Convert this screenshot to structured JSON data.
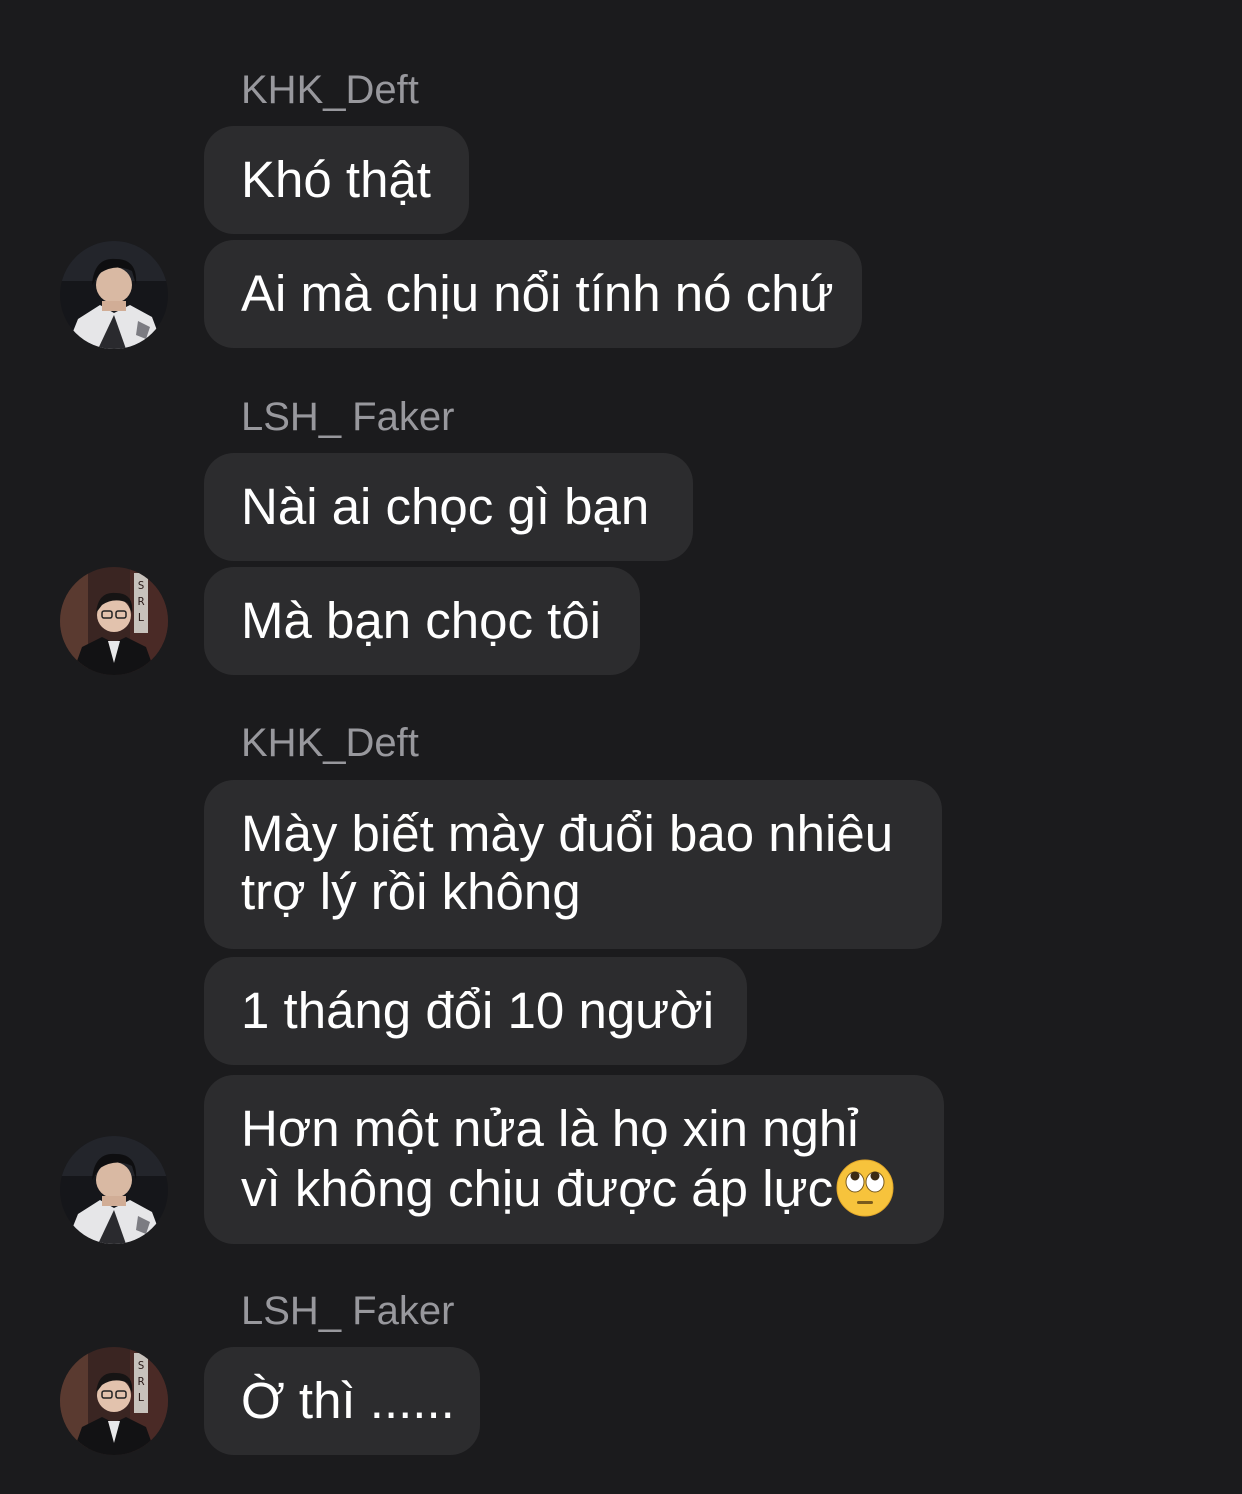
{
  "chat": {
    "senders": {
      "deft": "KHK_Deft",
      "faker": "LSH_ Faker"
    },
    "messages": {
      "m1": "Khó thật",
      "m2": "Ai mà chịu nổi tính nó chứ",
      "m3": "Nài ai chọc gì bạn",
      "m4": "Mà bạn chọc tôi",
      "m5": "Mày biết mày đuổi bao nhiêu trợ lý rồi không",
      "m6": "1 tháng đổi 10 người",
      "m7": "Hơn một nửa là họ xin nghỉ vì không chịu được áp lực",
      "m7_emoji": "face-with-rolling-eyes-icon",
      "m8": "Ờ thì ......"
    },
    "avatar_poster_text": "S.RL"
  },
  "colors": {
    "background": "#1b1b1d",
    "bubble": "#2c2c2e",
    "sender_name": "#98989d",
    "message_text": "#ffffff"
  }
}
